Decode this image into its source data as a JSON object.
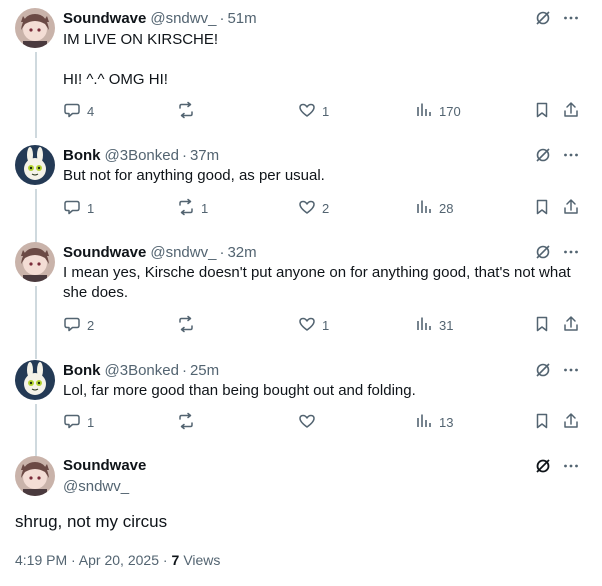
{
  "replies": [
    {
      "name": "Soundwave",
      "handle": "@sndwv_",
      "time": "51m",
      "text": "IM LIVE ON KIRSCHE!\n\nHI! ^.^ OMG HI!",
      "replies": "4",
      "reposts": "",
      "likes": "1",
      "views": "170",
      "avatar": "soundwave"
    },
    {
      "name": "Bonk",
      "handle": "@3Bonked",
      "time": "37m",
      "text": "But not for anything good, as per usual.",
      "replies": "1",
      "reposts": "1",
      "likes": "2",
      "views": "28",
      "avatar": "bonk"
    },
    {
      "name": "Soundwave",
      "handle": "@sndwv_",
      "time": "32m",
      "text": "I mean yes, Kirsche doesn't put anyone on for anything good, that's not what\nshe does.",
      "replies": "2",
      "reposts": "",
      "likes": "1",
      "views": "31",
      "avatar": "soundwave"
    },
    {
      "name": "Bonk",
      "handle": "@3Bonked",
      "time": "25m",
      "text": "Lol, far more good than being bought out and folding.",
      "replies": "1",
      "reposts": "",
      "likes": "",
      "views": "13",
      "avatar": "bonk"
    }
  ],
  "main": {
    "name": "Soundwave",
    "handle": "@sndwv_",
    "text": "shrug, not my circus",
    "timestamp": "4:19 PM · Apr 20, 2025 ·",
    "views_count": "7",
    "views_label": "Views"
  },
  "separator": "·",
  "colors": {
    "text": "#0f1419",
    "secondary": "#536471",
    "rail": "#cfd9de"
  },
  "icons": [
    "grok-icon",
    "more-icon",
    "reply-icon",
    "repost-icon",
    "like-icon",
    "views-icon",
    "bookmark-icon",
    "share-icon"
  ]
}
